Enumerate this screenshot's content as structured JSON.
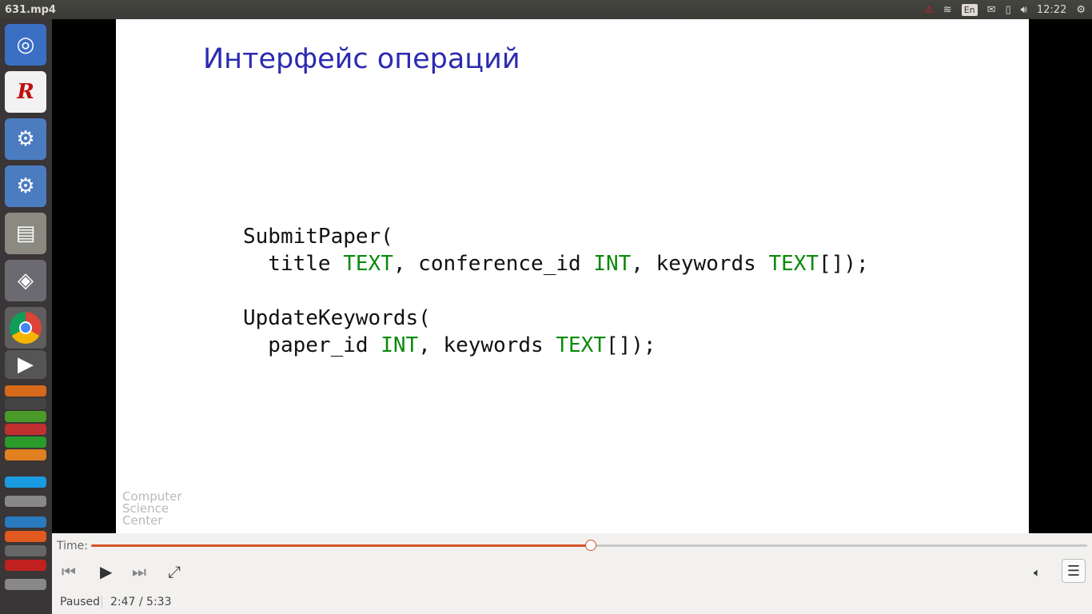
{
  "window": {
    "title": "631.mp4"
  },
  "tray": {
    "lang": "En",
    "clock": "12:22"
  },
  "slide": {
    "heading": "Интерфейс операций",
    "code": [
      [
        {
          "t": "SubmitPaper("
        }
      ],
      [
        {
          "t": "  title "
        },
        {
          "t": "TEXT",
          "k": 1
        },
        {
          "t": ", conference_id "
        },
        {
          "t": "INT",
          "k": 1
        },
        {
          "t": ", keywords "
        },
        {
          "t": "TEXT",
          "k": 1
        },
        {
          "t": "[]);"
        }
      ],
      [
        {
          "t": ""
        }
      ],
      [
        {
          "t": "UpdateKeywords("
        }
      ],
      [
        {
          "t": "  paper_id "
        },
        {
          "t": "INT",
          "k": 1
        },
        {
          "t": ", keywords "
        },
        {
          "t": "TEXT",
          "k": 1
        },
        {
          "t": "[]);"
        }
      ]
    ],
    "logo": [
      "Computer",
      "Science",
      "Center"
    ]
  },
  "player": {
    "time_label": "Time:",
    "status": "Paused",
    "position": "2:47 / 5:33",
    "progress_percent": 50.2,
    "accent": "#d5532a"
  }
}
